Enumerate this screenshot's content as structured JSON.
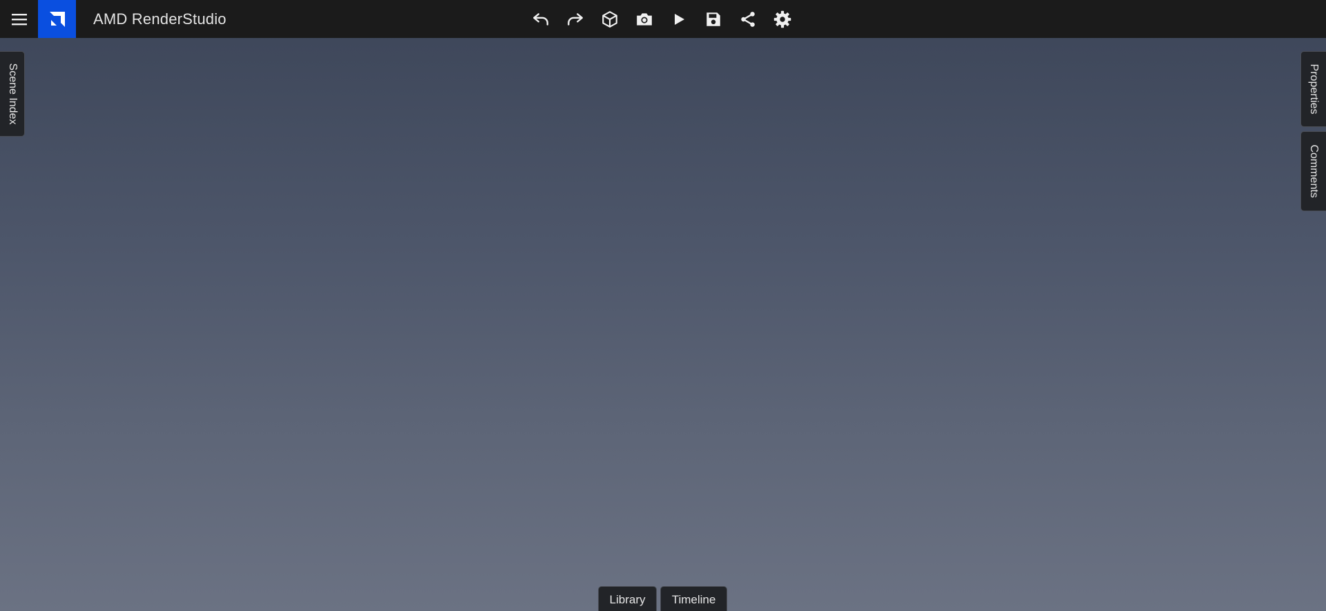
{
  "app": {
    "title": "AMD RenderStudio",
    "brand_color": "#0a4fe0",
    "topbar_color": "#1b1b1b"
  },
  "topbar": {
    "menu_icon": "hamburger-menu-icon",
    "logo_icon": "amd-logo-icon",
    "toolbar": [
      {
        "name": "undo",
        "icon": "undo-icon"
      },
      {
        "name": "redo",
        "icon": "redo-icon"
      },
      {
        "name": "3d-view",
        "icon": "cube-icon"
      },
      {
        "name": "screenshot",
        "icon": "camera-icon"
      },
      {
        "name": "play",
        "icon": "play-icon"
      },
      {
        "name": "save",
        "icon": "save-icon"
      },
      {
        "name": "share",
        "icon": "share-icon"
      },
      {
        "name": "settings",
        "icon": "gear-icon"
      }
    ]
  },
  "side_tabs": {
    "left": {
      "label": "Scene Index"
    },
    "right": [
      {
        "label": "Properties"
      },
      {
        "label": "Comments"
      }
    ]
  },
  "bottom_tabs": [
    {
      "label": "Library"
    },
    {
      "label": "Timeline"
    }
  ]
}
